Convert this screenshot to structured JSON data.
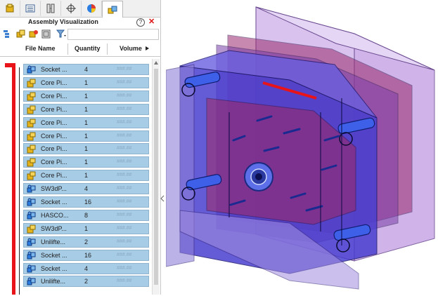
{
  "panel": {
    "title": "Assembly Visualization",
    "help_label": "?",
    "close_label": "✕",
    "tabs": [
      {
        "name": "feature-manager-tab",
        "icon": "part-icon"
      },
      {
        "name": "property-manager-tab",
        "icon": "list-icon"
      },
      {
        "name": "configuration-manager-tab",
        "icon": "config-icon"
      },
      {
        "name": "dimxpert-tab",
        "icon": "crosshair-icon"
      },
      {
        "name": "display-manager-tab",
        "icon": "pie-icon"
      },
      {
        "name": "assembly-visualization-tab",
        "icon": "assembly-icon"
      }
    ],
    "columns": {
      "name": "File Name",
      "quantity": "Quantity",
      "volume": "Volume"
    },
    "rows": [
      {
        "name": "Socket ...",
        "qty": "4",
        "vol": "###.##",
        "icon": "assembly-icon"
      },
      {
        "name": "Core Pi...",
        "qty": "1",
        "vol": "###.##",
        "icon": "part-icon"
      },
      {
        "name": "Core Pi...",
        "qty": "1",
        "vol": "###.##",
        "icon": "part-icon"
      },
      {
        "name": "Core Pi...",
        "qty": "1",
        "vol": "###.##",
        "icon": "part-icon"
      },
      {
        "name": "Core Pi...",
        "qty": "1",
        "vol": "###.##",
        "icon": "part-icon"
      },
      {
        "name": "Core Pi...",
        "qty": "1",
        "vol": "###.##",
        "icon": "part-icon"
      },
      {
        "name": "Core Pi...",
        "qty": "1",
        "vol": "###.##",
        "icon": "part-icon"
      },
      {
        "name": "Core Pi...",
        "qty": "1",
        "vol": "###.##",
        "icon": "part-icon"
      },
      {
        "name": "Core Pi...",
        "qty": "1",
        "vol": "###.##",
        "icon": "part-icon"
      },
      {
        "name": "SW3dP...",
        "qty": "4",
        "vol": "###.##",
        "icon": "assembly-icon"
      },
      {
        "name": "Socket ...",
        "qty": "16",
        "vol": "###.##",
        "icon": "assembly-icon"
      },
      {
        "name": "HASCO...",
        "qty": "8",
        "vol": "###.##",
        "icon": "assembly-icon"
      },
      {
        "name": "SW3dP...",
        "qty": "1",
        "vol": "###.##",
        "icon": "part-icon"
      },
      {
        "name": "Unilifte...",
        "qty": "2",
        "vol": "###.##",
        "icon": "assembly-icon"
      },
      {
        "name": "Socket ...",
        "qty": "16",
        "vol": "###.##",
        "icon": "assembly-icon"
      },
      {
        "name": "Socket ...",
        "qty": "4",
        "vol": "###.##",
        "icon": "assembly-icon"
      },
      {
        "name": "Unilifte...",
        "qty": "2",
        "vol": "###.##",
        "icon": "assembly-icon"
      }
    ]
  },
  "colors": {
    "selection": "#a7cce6",
    "marker": "#e8141a",
    "mold_blue": "#5a4fd6",
    "mold_purple": "#8a5ab8"
  }
}
